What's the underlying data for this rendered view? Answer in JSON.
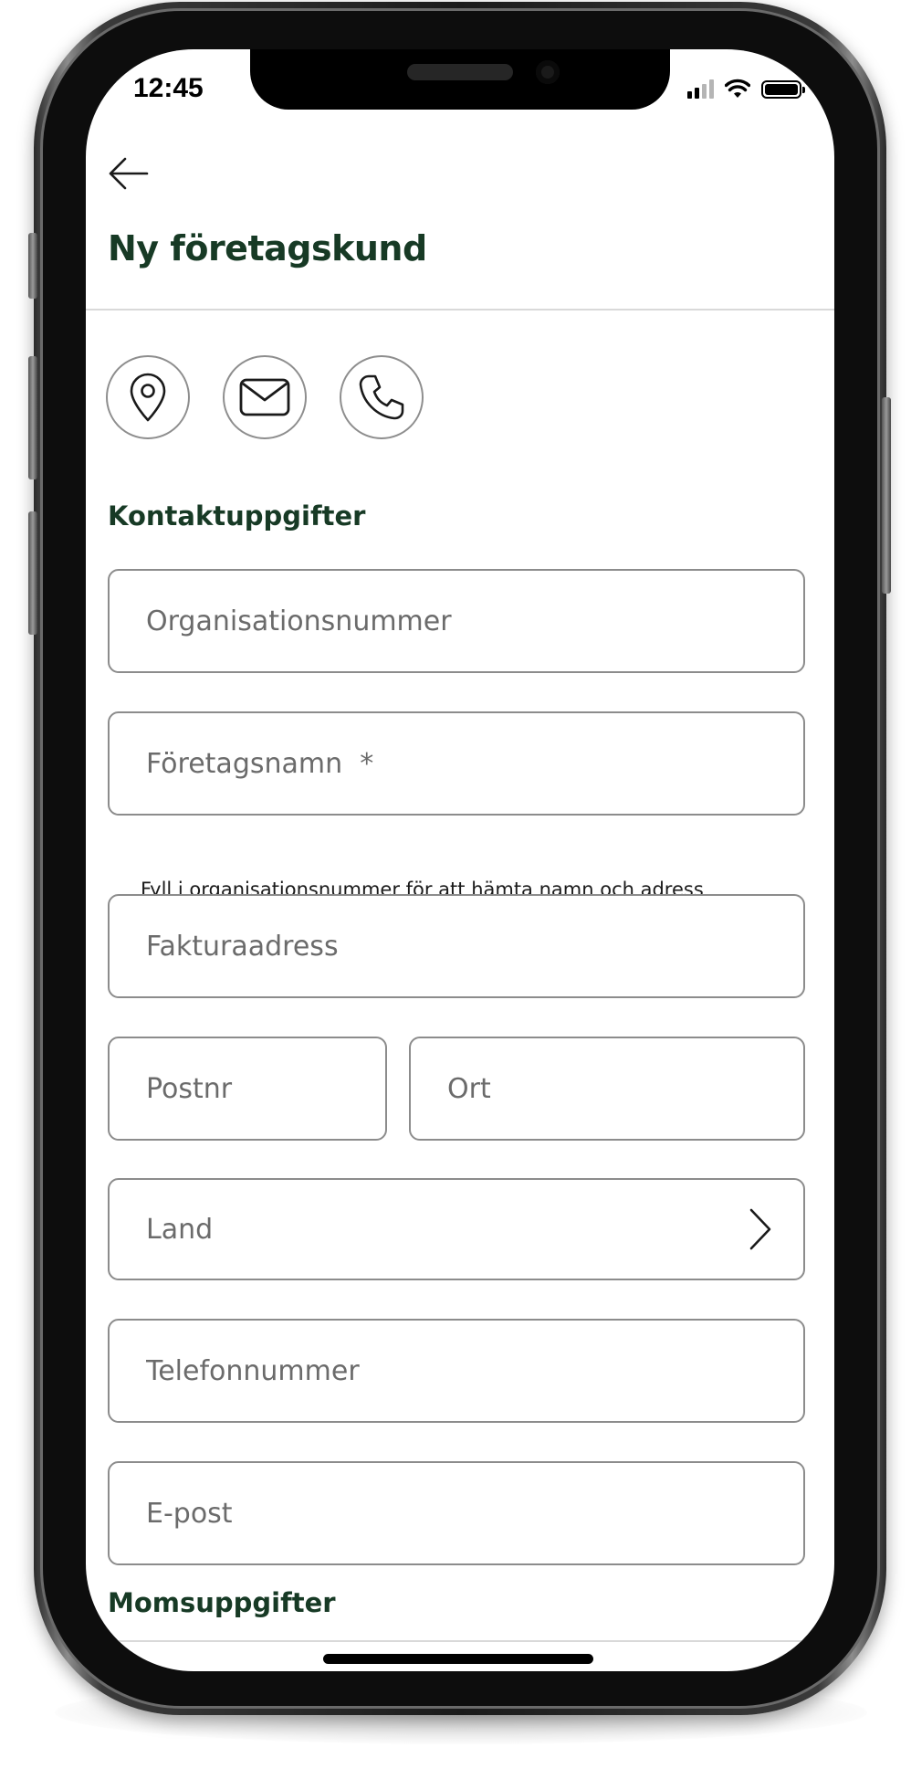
{
  "status_bar": {
    "time": "12:45"
  },
  "header": {
    "title": "Ny företagskund"
  },
  "sections": {
    "contact_title": "Kontaktuppgifter",
    "vat_title": "Momsuppgifter"
  },
  "fields": {
    "org_number": {
      "placeholder": "Organisationsnummer",
      "value": ""
    },
    "company_name": {
      "placeholder": "Företagsnamn  *",
      "value": ""
    },
    "helper_text": "Fyll i organisationsnummer för att hämta namn och adress",
    "invoice_address": {
      "placeholder": "Fakturaadress",
      "value": ""
    },
    "postal_code": {
      "placeholder": "Postnr",
      "value": ""
    },
    "city": {
      "placeholder": "Ort",
      "value": ""
    },
    "country": {
      "label": "Land"
    },
    "phone": {
      "placeholder": "Telefonnummer",
      "value": ""
    },
    "email": {
      "placeholder": "E-post",
      "value": ""
    }
  },
  "icons": {
    "back": "arrow-left-icon",
    "location": "map-pin-icon",
    "mail": "mail-icon",
    "phone": "phone-icon",
    "chevron": "chevron-right-icon"
  },
  "colors": {
    "accent_dark_green": "#173a25",
    "field_border": "#8c8c8c",
    "placeholder": "#6b6b6b"
  }
}
